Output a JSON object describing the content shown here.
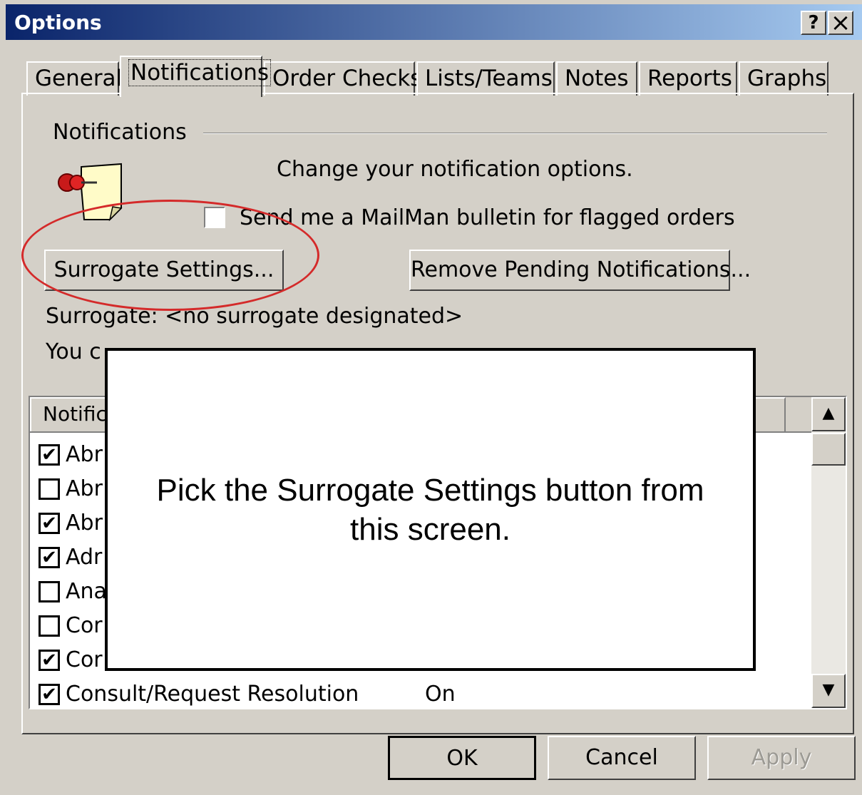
{
  "window": {
    "title": "Options",
    "help_btn": "?",
    "close_btn": "×"
  },
  "tabs": [
    {
      "label": "General"
    },
    {
      "label": "Notifications"
    },
    {
      "label": "Order Checks"
    },
    {
      "label": "Lists/Teams"
    },
    {
      "label": "Notes"
    },
    {
      "label": "Reports"
    },
    {
      "label": "Graphs"
    }
  ],
  "notifications": {
    "group_label": "Notifications",
    "description": "Change your notification options.",
    "mailman_checkbox": "Send me a MailMan bulletin for flagged orders",
    "surrogate_button": "Surrogate Settings...",
    "remove_button": "Remove Pending Notifications...",
    "surrogate_status": "Surrogate: <no surrogate designated>",
    "partial_text": "You c"
  },
  "list": {
    "header_partial": "Notific",
    "rows": [
      {
        "checked": true,
        "text": "Abr",
        "value": ""
      },
      {
        "checked": false,
        "text": "Abr",
        "value": ""
      },
      {
        "checked": true,
        "text": "Abr",
        "value": ""
      },
      {
        "checked": true,
        "text": "Adr",
        "value": ""
      },
      {
        "checked": false,
        "text": "Ana",
        "value": ""
      },
      {
        "checked": false,
        "text": "Cor",
        "value": ""
      },
      {
        "checked": true,
        "text": "Cor",
        "value": ""
      },
      {
        "checked": true,
        "text": "Consult/Request Resolution",
        "value": "On"
      }
    ]
  },
  "footer": {
    "ok": "OK",
    "cancel": "Cancel",
    "apply": "Apply"
  },
  "overlay": {
    "line1": "Pick the Surrogate Settings button from",
    "line2": "this screen."
  },
  "icons": {
    "pin": "pushpin-note-icon",
    "scroll_up": "▲",
    "scroll_down": "▼",
    "check": "✔"
  },
  "colors": {
    "titlebar_start": "#0a246a",
    "titlebar_end": "#a6caf0",
    "highlight_ellipse": "#d42a2a",
    "face": "#d4d0c8"
  }
}
